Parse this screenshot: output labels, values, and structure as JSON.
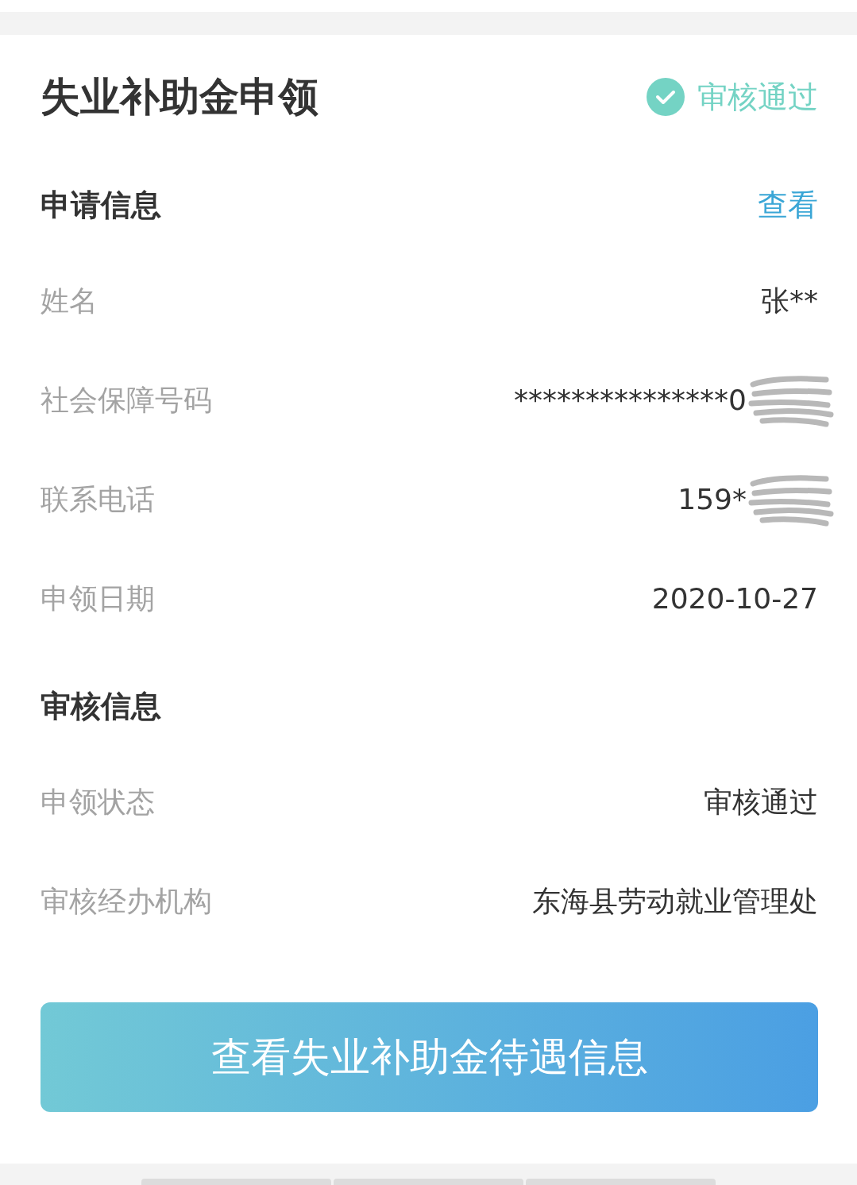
{
  "title": "失业补助金申领",
  "status": {
    "label": "审核通过",
    "kind": "approved"
  },
  "sections": [
    {
      "heading": "申请信息",
      "action": "查看",
      "rows": [
        {
          "label": "姓名",
          "value": "张**",
          "redacted": false
        },
        {
          "label": "社会保障号码",
          "value": "***************0",
          "redacted": true
        },
        {
          "label": "联系电话",
          "value": "159*",
          "redacted": true
        },
        {
          "label": "申领日期",
          "value": "2020-10-27",
          "redacted": false
        }
      ]
    },
    {
      "heading": "审核信息",
      "rows": [
        {
          "label": "申领状态",
          "value": "审核通过",
          "redacted": false
        },
        {
          "label": "审核经办机构",
          "value": "东海县劳动就业管理处",
          "redacted": false
        }
      ]
    }
  ],
  "button": "查看失业补助金待遇信息"
}
